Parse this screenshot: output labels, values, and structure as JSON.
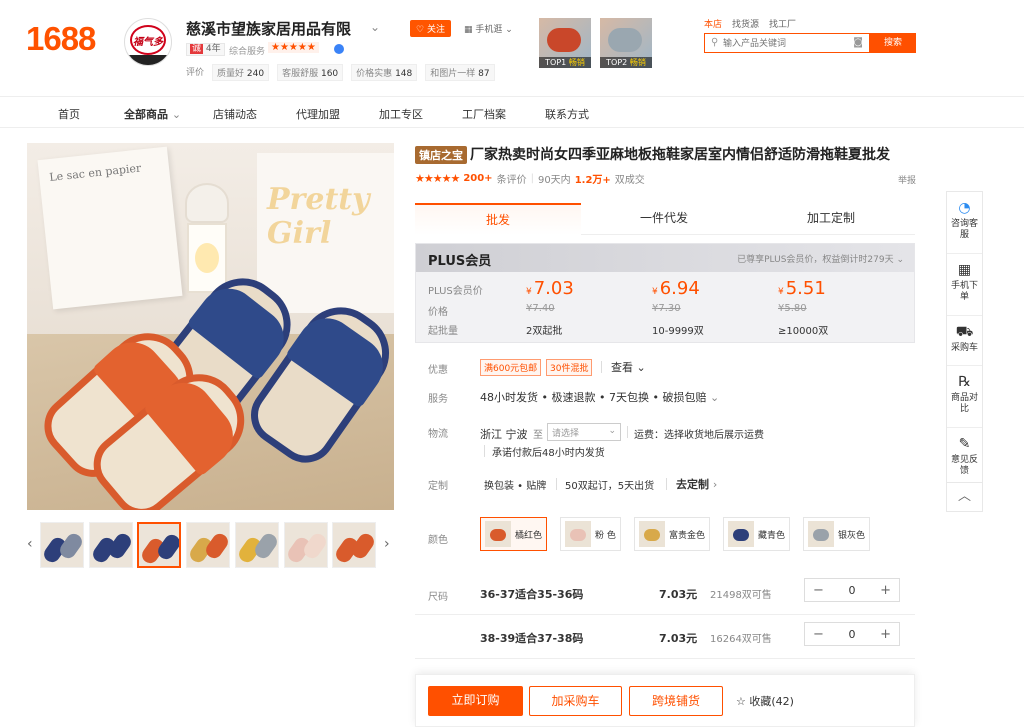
{
  "logo": "1688",
  "shop": {
    "avatar_text": "福气多",
    "name": "慈溪市望族家居用品有限",
    "years_badge": "4年",
    "service_label": "综合服务",
    "service_stars": "★★★★★",
    "follow_label": "关注",
    "mobile_label": "手机逛",
    "metrics": [
      {
        "label": "评价",
        "value": ""
      },
      {
        "label": "质量好",
        "value": "240"
      },
      {
        "label": "客服舒服",
        "value": "160"
      },
      {
        "label": "价格实惠",
        "value": "148"
      },
      {
        "label": "和图片一样",
        "value": "87"
      }
    ],
    "top_products": [
      {
        "rank": "TOP1",
        "tag": "畅销"
      },
      {
        "rank": "TOP2",
        "tag": "畅销"
      }
    ]
  },
  "search": {
    "scopes": [
      "本店",
      "找货源",
      "找工厂"
    ],
    "placeholder": "输入产品关键词",
    "button": "搜索"
  },
  "nav": [
    "首页",
    "全部商品",
    "店铺动态",
    "代理加盟",
    "加工专区",
    "工厂档案",
    "联系方式"
  ],
  "gallery": {
    "bag_text": "Le sac en papier",
    "poster_text": "Pretty Girl"
  },
  "product": {
    "store_badge": "镇店之宝",
    "title": "厂家热卖时尚女四季亚麻地板拖鞋家居室内情侣舒适防滑拖鞋夏批发",
    "stars": "★★★★★",
    "review_count": "200+",
    "review_label": "条评价",
    "sales_period": "90天内",
    "sales_count": "1.2万+",
    "sales_label": "双成交",
    "report": "举报"
  },
  "mode_tabs": [
    "批发",
    "一件代发",
    "加工定制"
  ],
  "plus": {
    "title": "PLUS会员",
    "note": "已尊享PLUS会员价，权益倒计时279天",
    "labels": [
      "PLUS会员价",
      "价格",
      "起批量"
    ],
    "tiers": [
      {
        "plus_price": "7.03",
        "price": "¥7.40",
        "moq": "2双起批"
      },
      {
        "plus_price": "6.94",
        "price": "¥7.30",
        "moq": "10-9999双"
      },
      {
        "plus_price": "5.51",
        "price": "¥5.80",
        "moq": "≥10000双"
      }
    ],
    "currency": "¥"
  },
  "promo": {
    "label": "优惠",
    "tags": [
      "满600元包邮",
      "30件混批"
    ],
    "see_more": "查看"
  },
  "service": {
    "label": "服务",
    "text": "48小时发货 • 极速退款 • 7天包换 • 破损包赔"
  },
  "logistics": {
    "label": "物流",
    "origin": "浙江 宁波",
    "to": "至",
    "select_placeholder": "请选择",
    "freight": "运费：选择收货地后展示运费",
    "promise": "承诺付款后48小时内发货"
  },
  "custom": {
    "label": "定制",
    "items": [
      "换包装 • 贴牌",
      "50双起订，5天出货"
    ],
    "link": "去定制"
  },
  "colors": {
    "label": "颜色",
    "options": [
      {
        "name": "橘红色",
        "swatch": "#d95b2c"
      },
      {
        "name": "粉 色",
        "swatch": "#e9c2b6"
      },
      {
        "name": "富贵金色",
        "swatch": "#d8a94a"
      },
      {
        "name": "藏青色",
        "swatch": "#2d3f7a"
      },
      {
        "name": "银灰色",
        "swatch": "#9aa2aa"
      }
    ]
  },
  "sizes": {
    "label": "尺码",
    "rows": [
      {
        "name": "36-37适合35-36码",
        "price": "7.03元",
        "stock": "21498双可售",
        "qty": "0"
      },
      {
        "name": "38-39适合37-38码",
        "price": "7.03元",
        "stock": "16264双可售",
        "qty": "0"
      }
    ]
  },
  "actions": {
    "order": "立即订购",
    "cart": "加采购车",
    "cross": "跨境铺货",
    "favorite": "收藏(42)"
  },
  "rail": [
    {
      "icon": "chat-icon",
      "label": "咨询客服"
    },
    {
      "icon": "qr-icon",
      "label": "手机下单"
    },
    {
      "icon": "cart-icon",
      "label": "采购车"
    },
    {
      "icon": "compare-icon",
      "label": "商品对比"
    },
    {
      "icon": "feedback-icon",
      "label": "意见反馈"
    }
  ],
  "colors_theme": {
    "accent": "#ff5000",
    "badge": "#a86a30"
  }
}
